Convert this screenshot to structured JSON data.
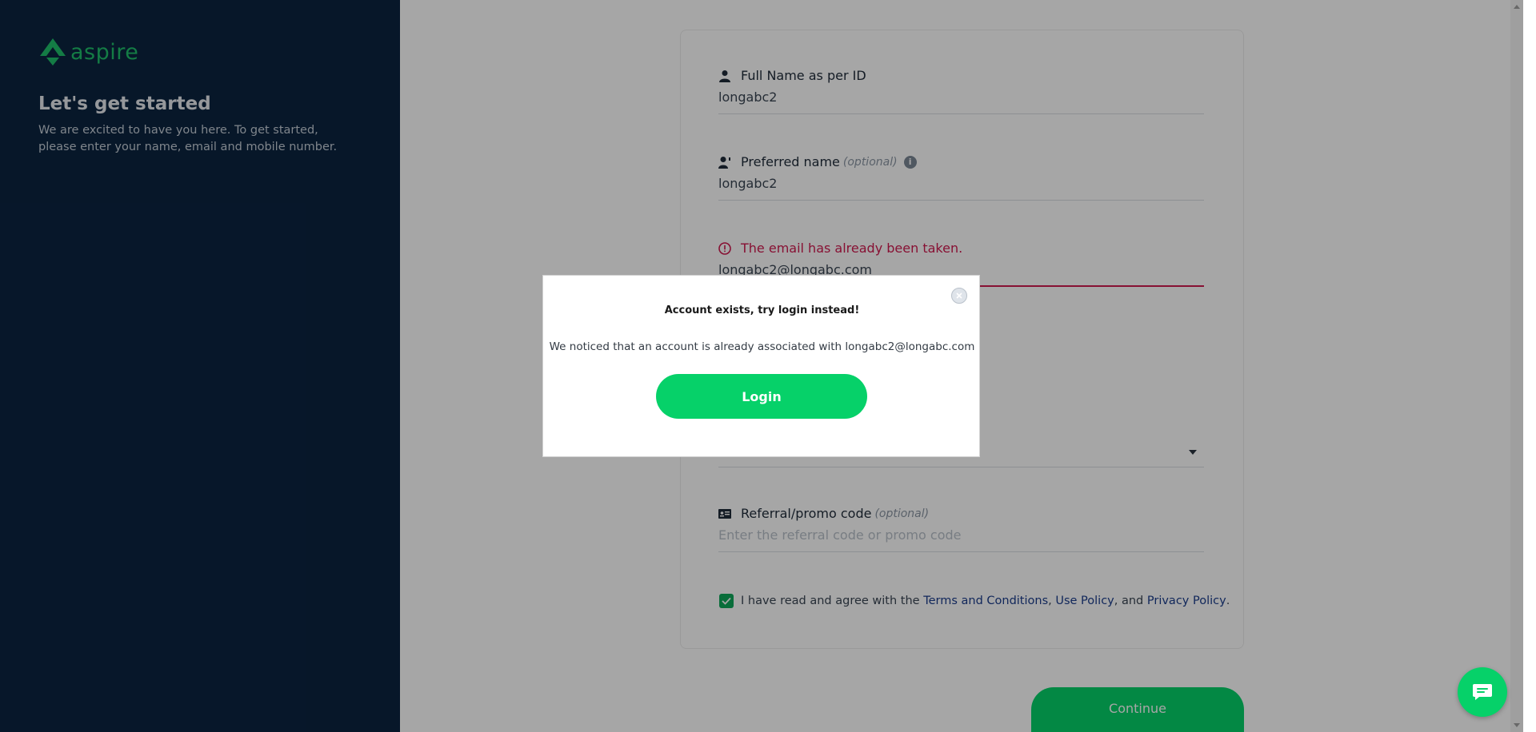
{
  "sidebar": {
    "logo_text": "aspire",
    "title": "Let's get started",
    "subtitle": "We are excited to have you here. To get started, please enter your name, email and mobile number."
  },
  "form": {
    "full_name": {
      "label": "Full Name as per ID",
      "value": "longabc2",
      "icon": "person-icon"
    },
    "preferred_name": {
      "label": "Preferred name",
      "optional": "(optional)",
      "value": "longabc2",
      "icon": "person-tag-icon"
    },
    "email": {
      "error": "The email has already been taken.",
      "value": "longabc2@longabc.com",
      "icon": "error-icon"
    },
    "referral": {
      "label": "Referral/promo code",
      "optional": "(optional)",
      "placeholder": "Enter the referral code or promo code",
      "icon": "id-card-icon"
    },
    "terms": {
      "prefix": "I have read and agree with the",
      "terms_link": "Terms and Conditions",
      "comma": ",",
      "use_link": "Use Policy",
      "and": ", and",
      "privacy_link": "Privacy Policy",
      "suffix": ".",
      "checked": true
    },
    "continue_label": "Continue"
  },
  "modal": {
    "title": "Account exists, try login instead!",
    "body": "We noticed that an account is already associated with longabc2@longabc.com",
    "login_label": "Login"
  },
  "colors": {
    "sidebar_bg": "#0b2440",
    "brand_green": "#06d169",
    "error_red": "#d0194f",
    "link_blue": "#1b3d8c"
  }
}
